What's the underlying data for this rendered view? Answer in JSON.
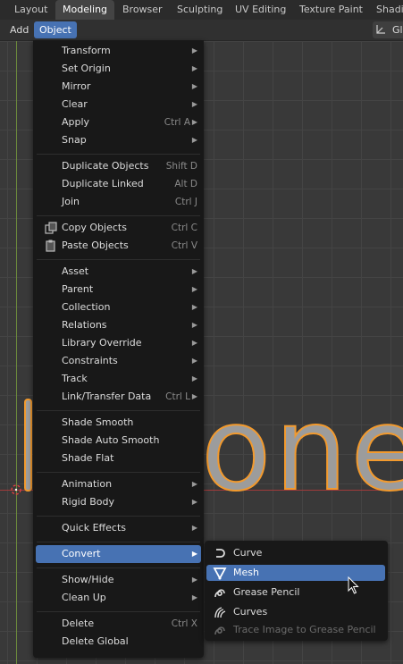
{
  "workspace_tabs": [
    "Layout",
    "Modeling",
    "Browser",
    "Sculpting",
    "UV Editing",
    "Texture Paint",
    "Shadi"
  ],
  "active_tab": "Modeling",
  "header": {
    "add_label": "Add",
    "object_label": "Object",
    "right_label": "Gl"
  },
  "viewport": {
    "text_object": "one"
  },
  "object_menu": {
    "transform": "Transform",
    "set_origin": "Set Origin",
    "mirror": "Mirror",
    "clear": "Clear",
    "apply": "Apply",
    "apply_shortcut": "Ctrl A",
    "snap": "Snap",
    "duplicate_objects": "Duplicate Objects",
    "duplicate_objects_shortcut": "Shift D",
    "duplicate_linked": "Duplicate Linked",
    "duplicate_linked_shortcut": "Alt D",
    "join": "Join",
    "join_shortcut": "Ctrl J",
    "copy_objects": "Copy Objects",
    "copy_objects_shortcut": "Ctrl C",
    "paste_objects": "Paste Objects",
    "paste_objects_shortcut": "Ctrl V",
    "asset": "Asset",
    "parent": "Parent",
    "collection": "Collection",
    "relations": "Relations",
    "library_override": "Library Override",
    "constraints": "Constraints",
    "track": "Track",
    "link_transfer": "Link/Transfer Data",
    "link_transfer_shortcut": "Ctrl L",
    "shade_smooth": "Shade Smooth",
    "shade_auto_smooth": "Shade Auto Smooth",
    "shade_flat": "Shade Flat",
    "animation": "Animation",
    "rigid_body": "Rigid Body",
    "quick_effects": "Quick Effects",
    "convert": "Convert",
    "show_hide": "Show/Hide",
    "clean_up": "Clean Up",
    "delete": "Delete",
    "delete_shortcut": "Ctrl X",
    "delete_global": "Delete Global"
  },
  "convert_submenu": {
    "curve": "Curve",
    "mesh": "Mesh",
    "grease_pencil": "Grease Pencil",
    "curves": "Curves",
    "trace_image": "Trace Image to Grease Pencil"
  },
  "colors": {
    "accent": "#4772b3",
    "menu_bg": "#181818",
    "outline": "#f29a2e"
  }
}
